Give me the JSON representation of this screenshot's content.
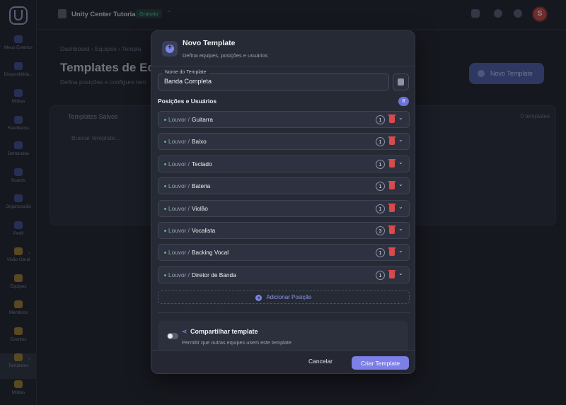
{
  "app": {
    "org_name": "Unity Center Tutorial",
    "plan": "Gratuito",
    "avatar_initial": "S"
  },
  "sidebar": {
    "items": [
      {
        "label": "Meus Eventos"
      },
      {
        "label": "Disponibilida..."
      },
      {
        "label": "Mídias"
      },
      {
        "label": "Feedbacks"
      },
      {
        "label": "Demandas"
      },
      {
        "label": "Boards"
      },
      {
        "label": "Organização"
      },
      {
        "label": "Perfil"
      },
      {
        "label": "Visão Geral"
      },
      {
        "label": "Equipes"
      },
      {
        "label": "Membros"
      },
      {
        "label": "Eventos"
      },
      {
        "label": "Templates"
      },
      {
        "label": "Mídias"
      }
    ]
  },
  "background_page": {
    "breadcrumb": "Dashboard › Equipes › Templa",
    "title": "Templates de Equ",
    "subtitle": "Defina posições e configure tem",
    "new_button": "Novo Template",
    "card_title": "Templates Salvos",
    "card_count": "0 templates",
    "search_placeholder": "Buscar template..."
  },
  "modal": {
    "title": "Novo Template",
    "subtitle": "Defina equipes, posições e usuários",
    "name_label": "Nome do Template",
    "name_value": "Banda Completa",
    "positions_title": "Posições e Usuários",
    "positions_count": "8",
    "positions": [
      {
        "group": "Louvor /",
        "name": "Guitarra",
        "count": "1"
      },
      {
        "group": "Louvor /",
        "name": "Baixo",
        "count": "1"
      },
      {
        "group": "Louvor /",
        "name": "Teclado",
        "count": "1"
      },
      {
        "group": "Louvor /",
        "name": "Bateria",
        "count": "1"
      },
      {
        "group": "Louvor /",
        "name": "Violão",
        "count": "1"
      },
      {
        "group": "Louvor /",
        "name": "Vocalista",
        "count": "3"
      },
      {
        "group": "Louvor /",
        "name": "Backing Vocal",
        "count": "1"
      },
      {
        "group": "Louvor /",
        "name": "Diretor de Banda",
        "count": "1"
      }
    ],
    "add_position": "Adicionar Posição",
    "share_title": "Compartilhar template",
    "share_subtitle": "Permitir que outras equipes usem este template",
    "share_enabled": false,
    "cancel_label": "Cancelar",
    "create_label": "Criar Template"
  },
  "colors": {
    "accent": "#7b7fe6",
    "danger": "#d94a4a",
    "status_green": "#49c46b"
  }
}
